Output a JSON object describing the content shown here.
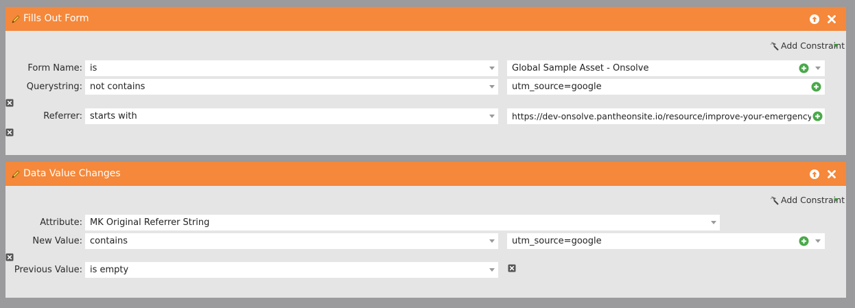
{
  "panels": [
    {
      "title": "Fills Out Form",
      "add_constraint": "Add Constraint",
      "rows": [
        {
          "label": "Form Name:",
          "operator": "is",
          "value": "Global Sample Asset - Onsolve"
        },
        {
          "label": "Querystring:",
          "operator": "not contains",
          "value": "utm_source=google"
        },
        {
          "label": "Referrer:",
          "operator": "starts with",
          "value": "https://dev-onsolve.pantheonsite.io/resource/improve-your-emergency-co"
        }
      ]
    },
    {
      "title": "Data Value Changes",
      "add_constraint": "Add Constraint",
      "rows": [
        {
          "label": "Attribute:",
          "operator": "MK Original Referrer String"
        },
        {
          "label": "New Value:",
          "operator": "contains",
          "value": "utm_source=google"
        },
        {
          "label": "Previous Value:",
          "operator": "is empty"
        }
      ]
    }
  ],
  "colors": {
    "header": "#f5883a",
    "panel_bg": "#e5e5e5",
    "page_bg": "#9b9a9c",
    "add_green": "#4aa84a"
  },
  "icons": [
    "pencil-icon",
    "move-up-icon",
    "close-icon",
    "wand-icon",
    "add-circle-icon",
    "remove-x-icon",
    "dropdown-caret-icon"
  ]
}
